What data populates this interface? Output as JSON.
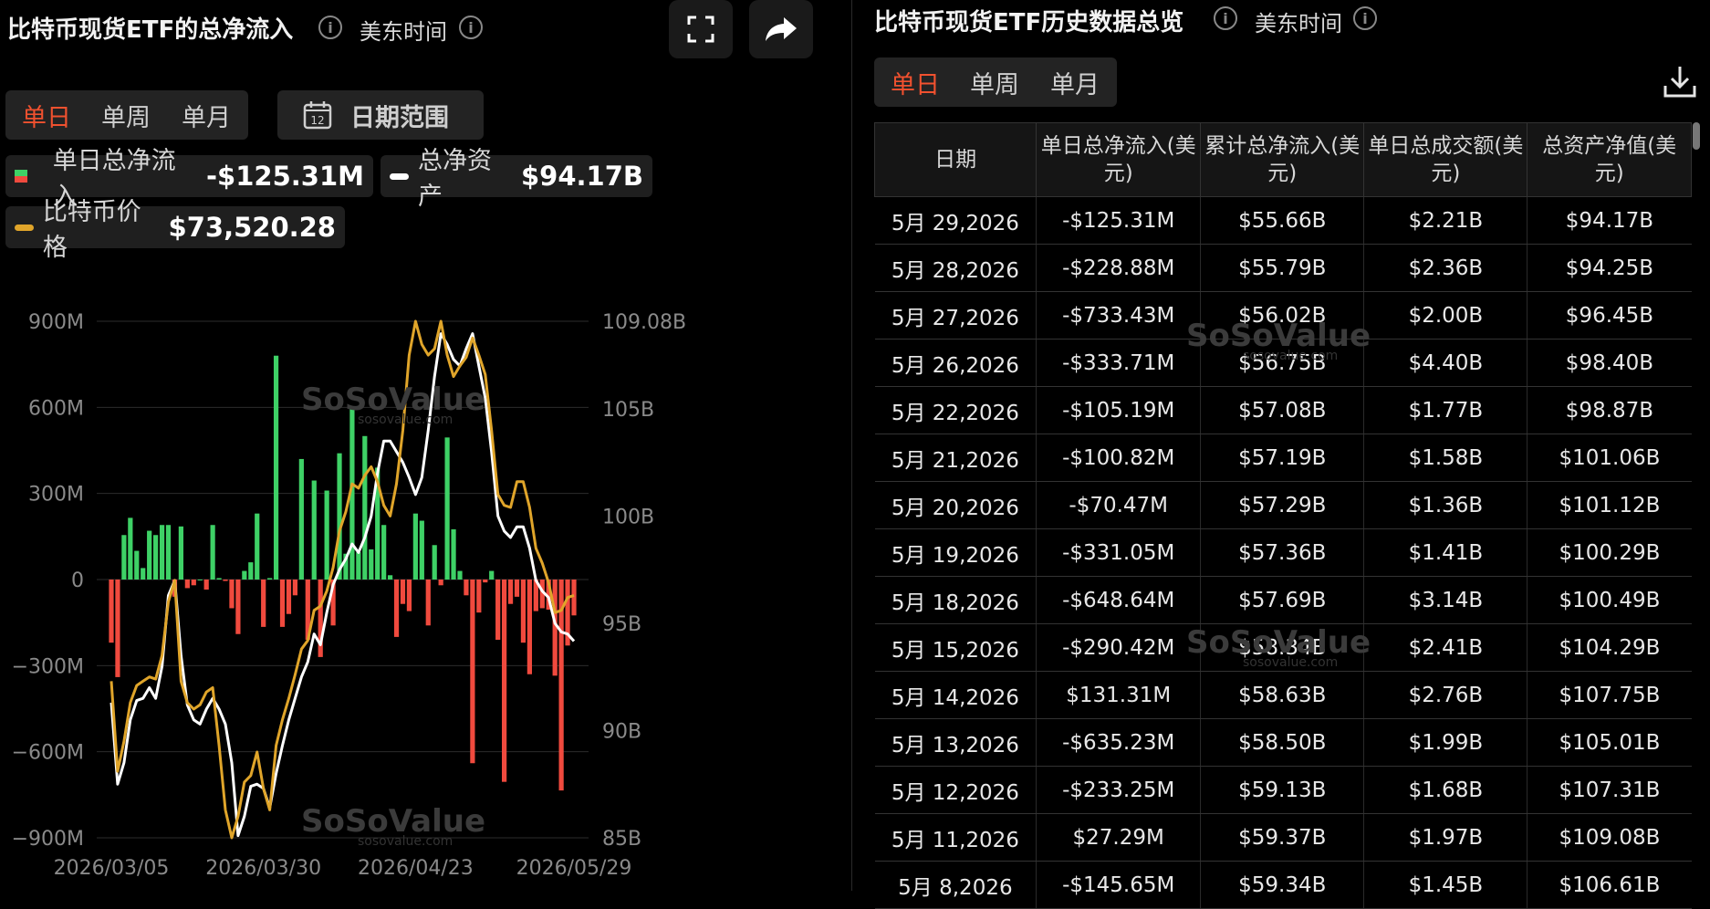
{
  "left_panel": {
    "title": "比特币现货ETF的总净流入",
    "timezone": "美东时间",
    "tabs": [
      "单日",
      "单周",
      "单月"
    ],
    "active_tab": "单日",
    "date_range_label": "日期范围",
    "legend": {
      "daily_flow_label": "单日总净流入",
      "daily_flow_value": "-$125.31M",
      "net_assets_label": "总净资产",
      "net_assets_value": "$94.17B",
      "btc_price_label": "比特币价格",
      "btc_price_value": "$73,520.28"
    },
    "watermark": "SoSoValue",
    "watermark_url": "sosovalue.com"
  },
  "right_panel": {
    "title": "比特币现货ETF历史数据总览",
    "timezone": "美东时间",
    "tabs": [
      "单日",
      "单周",
      "单月"
    ],
    "active_tab": "单日",
    "columns": [
      "日期",
      "单日总净流入(美元)",
      "累计总净流入(美元)",
      "单日总成交额(美元)",
      "总资产净值(美元)"
    ],
    "rows": [
      {
        "date": "5月 29,2026",
        "flow": "-$125.31M",
        "cum": "$55.66B",
        "vol": "$2.21B",
        "nav": "$94.17B",
        "sign": "neg"
      },
      {
        "date": "5月 28,2026",
        "flow": "-$228.88M",
        "cum": "$55.79B",
        "vol": "$2.36B",
        "nav": "$94.25B",
        "sign": "neg"
      },
      {
        "date": "5月 27,2026",
        "flow": "-$733.43M",
        "cum": "$56.02B",
        "vol": "$2.00B",
        "nav": "$96.45B",
        "sign": "neg"
      },
      {
        "date": "5月 26,2026",
        "flow": "-$333.71M",
        "cum": "$56.75B",
        "vol": "$4.40B",
        "nav": "$98.40B",
        "sign": "neg"
      },
      {
        "date": "5月 22,2026",
        "flow": "-$105.19M",
        "cum": "$57.08B",
        "vol": "$1.77B",
        "nav": "$98.87B",
        "sign": "neg"
      },
      {
        "date": "5月 21,2026",
        "flow": "-$100.82M",
        "cum": "$57.19B",
        "vol": "$1.58B",
        "nav": "$101.06B",
        "sign": "neg"
      },
      {
        "date": "5月 20,2026",
        "flow": "-$70.47M",
        "cum": "$57.29B",
        "vol": "$1.36B",
        "nav": "$101.12B",
        "sign": "neg"
      },
      {
        "date": "5月 19,2026",
        "flow": "-$331.05M",
        "cum": "$57.36B",
        "vol": "$1.41B",
        "nav": "$100.29B",
        "sign": "neg"
      },
      {
        "date": "5月 18,2026",
        "flow": "-$648.64M",
        "cum": "$57.69B",
        "vol": "$3.14B",
        "nav": "$100.49B",
        "sign": "neg"
      },
      {
        "date": "5月 15,2026",
        "flow": "-$290.42M",
        "cum": "$58.34B",
        "vol": "$2.41B",
        "nav": "$104.29B",
        "sign": "neg"
      },
      {
        "date": "5月 14,2026",
        "flow": "$131.31M",
        "cum": "$58.63B",
        "vol": "$2.76B",
        "nav": "$107.75B",
        "sign": "pos"
      },
      {
        "date": "5月 13,2026",
        "flow": "-$635.23M",
        "cum": "$58.50B",
        "vol": "$1.99B",
        "nav": "$105.01B",
        "sign": "neg"
      },
      {
        "date": "5月 12,2026",
        "flow": "-$233.25M",
        "cum": "$59.13B",
        "vol": "$1.68B",
        "nav": "$107.31B",
        "sign": "neg"
      },
      {
        "date": "5月 11,2026",
        "flow": "$27.29M",
        "cum": "$59.37B",
        "vol": "$1.97B",
        "nav": "$109.08B",
        "sign": "pos"
      },
      {
        "date": "5月 8,2026",
        "flow": "-$145.65M",
        "cum": "$59.34B",
        "vol": "$1.45B",
        "nav": "$106.61B",
        "sign": "neg"
      }
    ]
  },
  "chart_data": {
    "type": "bar",
    "title": "",
    "ylim_left": [
      -900,
      900
    ],
    "ylim_right": [
      85,
      109.08
    ],
    "left_ticks": [
      "900M",
      "600M",
      "300M",
      "0",
      "−300M",
      "−600M",
      "−900M"
    ],
    "right_ticks": [
      "109.08B",
      "105B",
      "100B",
      "95B",
      "90B",
      "85B"
    ],
    "x_tick_labels": [
      "2026/03/05",
      "2026/03/30",
      "2026/04/23",
      "2026/05/29"
    ],
    "series": [
      {
        "name": "单日总净流入",
        "kind": "bar",
        "unit": "M USD",
        "values": [
          -220,
          -340,
          155,
          215,
          100,
          40,
          170,
          155,
          190,
          190,
          -60,
          185,
          -30,
          -20,
          0,
          -35,
          190,
          5,
          -5,
          -100,
          -190,
          30,
          60,
          230,
          -165,
          5,
          780,
          -165,
          -120,
          -55,
          420,
          -210,
          345,
          -270,
          310,
          -160,
          440,
          90,
          600,
          95,
          500,
          105,
          390,
          190,
          15,
          -200,
          -85,
          -110,
          230,
          205,
          -160,
          120,
          -20,
          495,
          175,
          30,
          -55,
          -640,
          -115,
          -10,
          30,
          -210,
          -705,
          -85,
          -60,
          -220,
          -330,
          -110,
          -100,
          -105,
          -335,
          -735,
          -230,
          -125
        ],
        "colors": {
          "positive": "#3ed166",
          "negative": "#f04a3e"
        }
      },
      {
        "name": "总净资产",
        "kind": "line",
        "unit": "B USD",
        "color": "#ffffff",
        "values": [
          91.3,
          87.5,
          88.5,
          90.5,
          91.4,
          91.5,
          92.0,
          91.5,
          93.0,
          96.3,
          97.0,
          93.5,
          91.2,
          90.5,
          90.3,
          91.0,
          91.5,
          91.0,
          90.3,
          88.5,
          85.1,
          86.0,
          87.4,
          87.5,
          87.3,
          86.4,
          88.0,
          89.3,
          90.5,
          91.5,
          92.5,
          93.2,
          94.5,
          94.0,
          95.5,
          96.8,
          97.5,
          98.0,
          98.7,
          98.3,
          99.0,
          100.0,
          102.0,
          103.5,
          103.5,
          103.0,
          102.5,
          101.8,
          101.0,
          101.8,
          104.0,
          106.5,
          108.5,
          108.0,
          107.3,
          107.0,
          107.8,
          108.5,
          107.0,
          105.5,
          103.0,
          100.0,
          99.3,
          99.0,
          99.5,
          99.5,
          98.5,
          97.0,
          96.5,
          96.2,
          95.0,
          94.6,
          94.5,
          94.17
        ]
      },
      {
        "name": "比特币价格",
        "kind": "line",
        "color": "#e0a52a",
        "values_on_right_scale": [
          92.3,
          88.1,
          89.5,
          91.3,
          92.1,
          92.3,
          92.5,
          92.4,
          93.5,
          96.0,
          97.0,
          92.3,
          91.3,
          91.0,
          91.2,
          91.8,
          92.0,
          89.3,
          86.3,
          85.0,
          86.0,
          87.6,
          87.9,
          89.0,
          87.3,
          86.3,
          89.3,
          90.5,
          91.5,
          92.6,
          93.8,
          94.2,
          95.6,
          95.8,
          96.5,
          97.6,
          99.3,
          100.2,
          101.5,
          101.3,
          101.9,
          102.3,
          101.6,
          100.5,
          100.0,
          101.5,
          104.0,
          107.5,
          109.08,
          108.0,
          107.5,
          107.8,
          109.08,
          107.5,
          106.5,
          107.0,
          107.4,
          108.3,
          107.5,
          106.6,
          104.0,
          101.0,
          100.5,
          100.4,
          101.6,
          101.6,
          100.4,
          98.5,
          97.8,
          96.9,
          95.5,
          95.6,
          96.2,
          96.3
        ]
      }
    ],
    "grid": true
  }
}
